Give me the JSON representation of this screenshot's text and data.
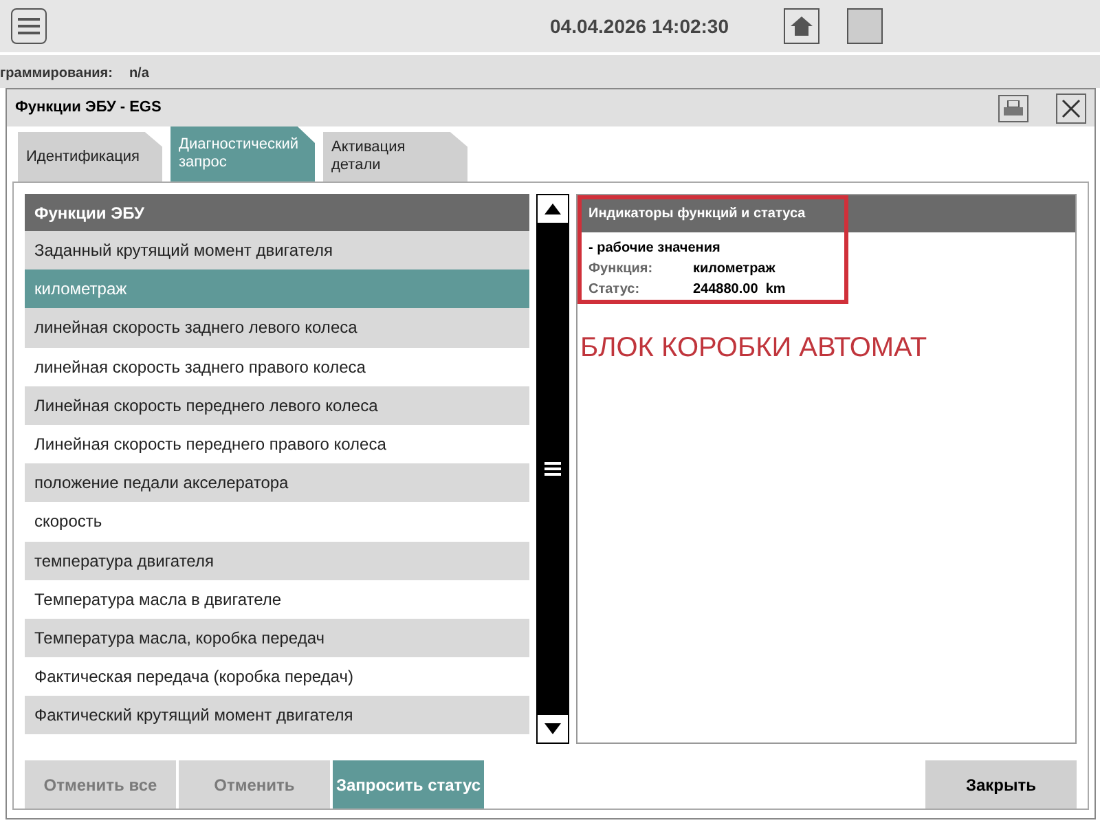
{
  "top_bar": {
    "datetime": "04.04.2026 14:02:30"
  },
  "background": {
    "label": "граммирования:",
    "value": "n/a"
  },
  "dialog": {
    "title": "Функции ЭБУ - EGS",
    "tabs": [
      {
        "label": "Идентификация",
        "selected": false
      },
      {
        "label": "Диагностический запрос",
        "selected": true
      },
      {
        "label": "Активация детали",
        "selected": false
      }
    ],
    "list": {
      "header": "Функции ЭБУ",
      "items": [
        {
          "label": "Заданный крутящий момент двигателя",
          "selected": false
        },
        {
          "label": "километраж",
          "selected": true
        },
        {
          "label": "линейная скорость заднего левого колеса",
          "selected": false
        },
        {
          "label": "линейная скорость заднего правого колеса",
          "selected": false
        },
        {
          "label": "Линейная скорость переднего левого колеса",
          "selected": false
        },
        {
          "label": "Линейная скорость переднего правого колеса",
          "selected": false
        },
        {
          "label": "положение педали акселератора",
          "selected": false
        },
        {
          "label": "скорость",
          "selected": false
        },
        {
          "label": "температура двигателя",
          "selected": false
        },
        {
          "label": "Температура масла в двигателе",
          "selected": false
        },
        {
          "label": "Температура масла, коробка передач",
          "selected": false
        },
        {
          "label": "Фактическая передача (коробка передач)",
          "selected": false
        },
        {
          "label": "Фактический крутящий момент двигателя",
          "selected": false
        }
      ]
    },
    "status_panel": {
      "header": "Индикаторы функций и статуса",
      "subtitle": "- рабочие значения",
      "fields": [
        {
          "label": "Функция:",
          "value": "километраж"
        },
        {
          "label": "Статус:",
          "value": "244880.00  km"
        }
      ],
      "annotation": "БЛОК КОРОБКИ АВТОМАТ"
    },
    "buttons": [
      {
        "label": "Отменить все",
        "disabled": true,
        "kind": "secondary"
      },
      {
        "label": "Отменить",
        "disabled": true,
        "kind": "secondary"
      },
      {
        "label": "Запросить статус",
        "disabled": false,
        "kind": "primary"
      },
      {
        "label": "Закрыть",
        "disabled": false,
        "kind": "secondary"
      }
    ]
  }
}
